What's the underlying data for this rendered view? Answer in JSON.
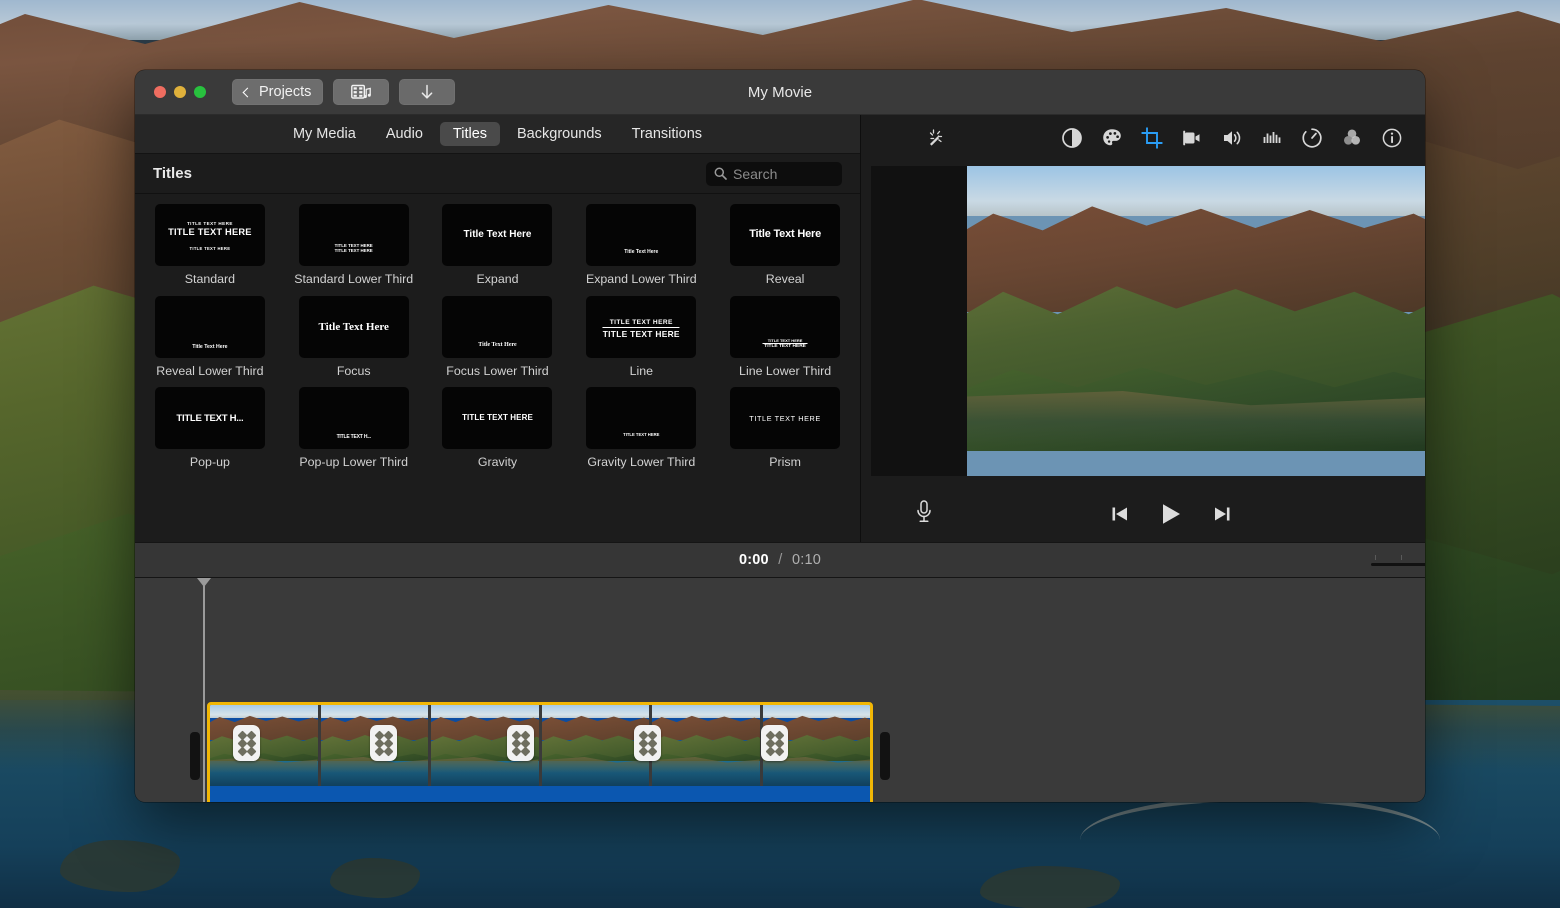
{
  "window": {
    "title": "My Movie",
    "traffic_lights": [
      "close",
      "minimize",
      "zoom"
    ],
    "toolbar": {
      "back_label": "Projects",
      "media_button": "import-media",
      "share_button": "share-export"
    }
  },
  "browser": {
    "tabs": [
      {
        "label": "My Media",
        "active": false
      },
      {
        "label": "Audio",
        "active": false
      },
      {
        "label": "Titles",
        "active": true
      },
      {
        "label": "Backgrounds",
        "active": false
      },
      {
        "label": "Transitions",
        "active": false
      }
    ],
    "heading": "Titles",
    "search": {
      "placeholder": "Search",
      "value": "",
      "icon": "search-icon"
    },
    "items": [
      {
        "label": "Standard",
        "preview": [
          "TITLE TEXT HERE",
          "TITLE TEXT HERE",
          "TITLE TEXT HERE"
        ]
      },
      {
        "label": "Standard Lower Third",
        "preview": [
          "TITLE TEXT HERE",
          "TITLE TEXT HERE"
        ]
      },
      {
        "label": "Expand",
        "preview": [
          "Title Text Here"
        ]
      },
      {
        "label": "Expand Lower Third",
        "preview": [
          "Title Text Here"
        ]
      },
      {
        "label": "Reveal",
        "preview": [
          "Title Text Here"
        ]
      },
      {
        "label": "Reveal Lower Third",
        "preview": [
          "Title Text Here"
        ]
      },
      {
        "label": "Focus",
        "preview": [
          "Title Text Here"
        ]
      },
      {
        "label": "Focus Lower Third",
        "preview": [
          "Title Text Here"
        ]
      },
      {
        "label": "Line",
        "preview": [
          "TITLE TEXT HERE",
          "TITLE TEXT HERE"
        ]
      },
      {
        "label": "Line Lower Third",
        "preview": [
          "TITLE TEXT HERE",
          "TITLE TEXT HERE"
        ]
      },
      {
        "label": "Pop-up",
        "preview": [
          "TITLE TEXT H..."
        ]
      },
      {
        "label": "Pop-up Lower Third",
        "preview": [
          "TITLE TEXT H..."
        ]
      },
      {
        "label": "Gravity",
        "preview": [
          "TITLE TEXT HERE"
        ]
      },
      {
        "label": "Gravity Lower Third",
        "preview": [
          "TITLE TEXT HERE"
        ]
      },
      {
        "label": "Prism",
        "preview": [
          "TITLE TEXT HERE"
        ]
      }
    ]
  },
  "viewer": {
    "enhance_icon": "magic-wand-icon",
    "adjust_icons": [
      {
        "name": "color-balance-icon",
        "active": false
      },
      {
        "name": "color-correction-icon",
        "active": false
      },
      {
        "name": "crop-icon",
        "active": true
      },
      {
        "name": "stabilization-icon",
        "active": false
      },
      {
        "name": "volume-icon",
        "active": false
      },
      {
        "name": "noise-reduction-icon",
        "active": false
      },
      {
        "name": "speed-icon",
        "active": false
      },
      {
        "name": "filters-icon",
        "active": false
      },
      {
        "name": "info-icon",
        "active": false
      }
    ],
    "accent_color": "#2a9df4",
    "transport": {
      "voiceover_icon": "microphone-icon",
      "previous_icon": "skip-previous-icon",
      "play_icon": "play-icon",
      "next_icon": "skip-next-icon"
    }
  },
  "timeline": {
    "current_time": "0:00",
    "separator": "/",
    "duration": "0:10",
    "zoom_slider_value": 50,
    "clip": {
      "selected": true,
      "selection_color": "#f2b705",
      "audio_bar_color": "#0b57b0",
      "thumbnail_count": 5,
      "drag_badge_count": 5
    }
  }
}
